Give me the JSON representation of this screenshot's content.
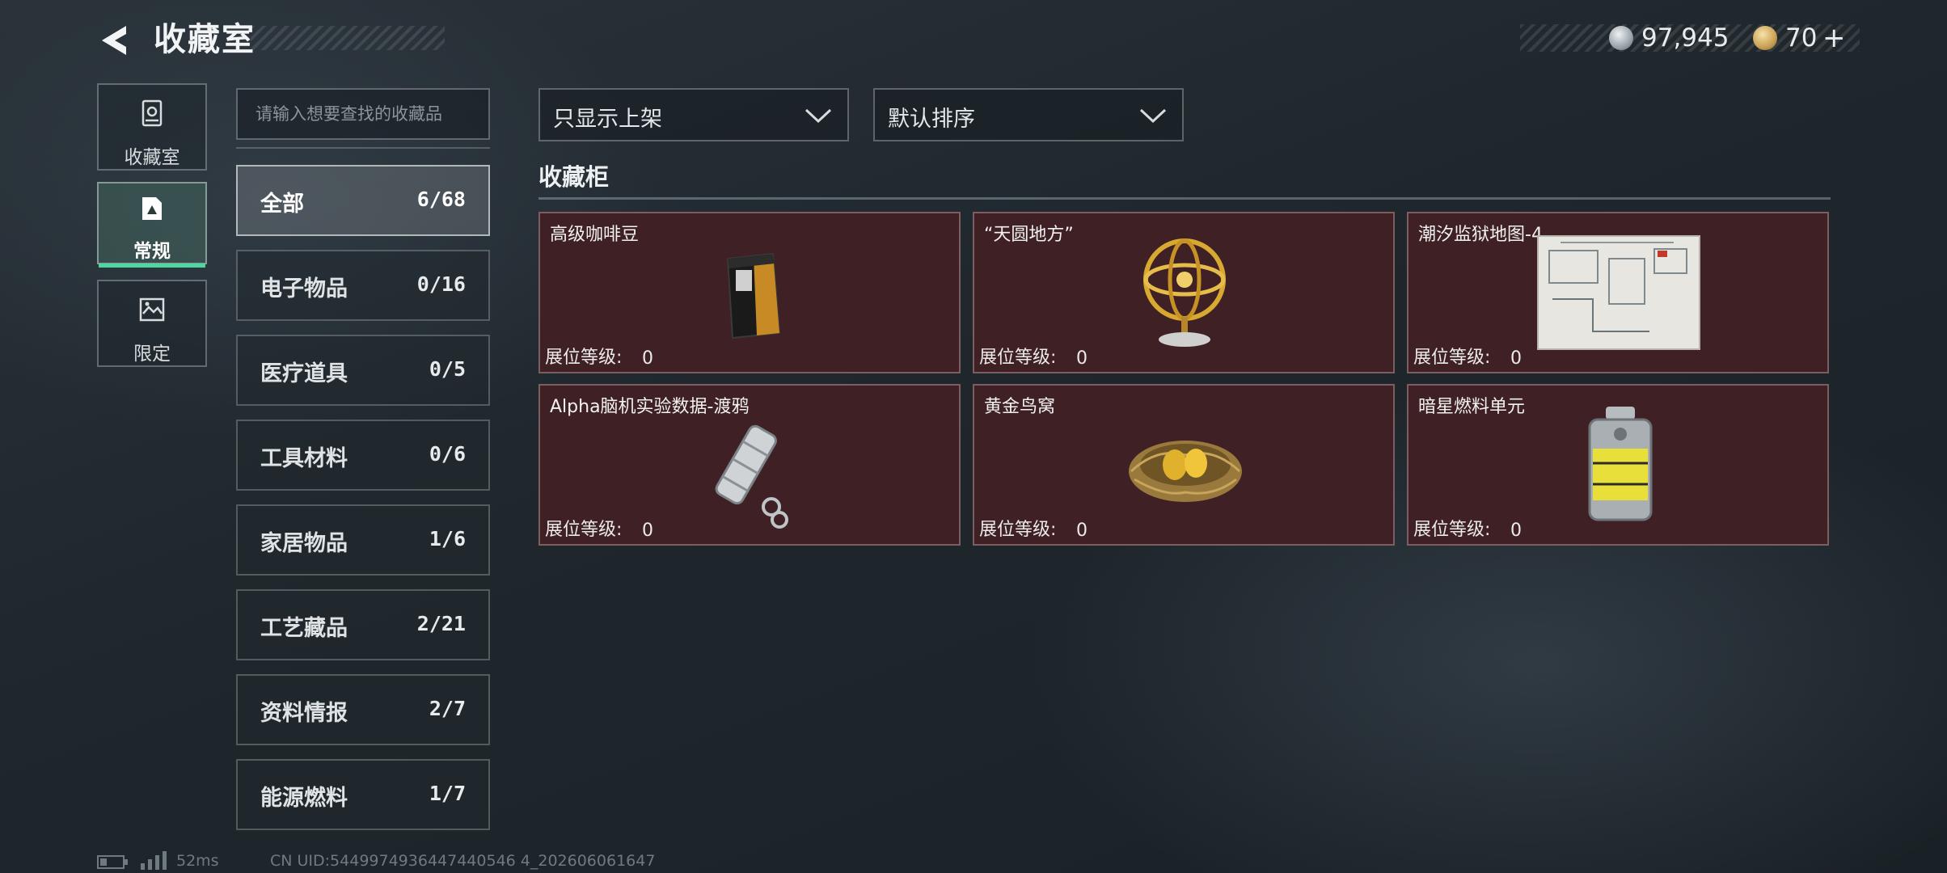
{
  "header": {
    "title": "收藏室",
    "currency": [
      {
        "icon": "silver-coin-icon",
        "value": "97,945",
        "color": "#c9ced2"
      },
      {
        "icon": "gold-coin-icon",
        "value": "70",
        "plus": "+",
        "color": "#d9b36a"
      }
    ]
  },
  "nav": {
    "items": [
      {
        "label": "收藏室",
        "icon": "cabinet-icon"
      },
      {
        "label": "常规",
        "icon": "frame-icon",
        "active": true
      },
      {
        "label": "限定",
        "icon": "map-frame-icon"
      }
    ]
  },
  "search": {
    "placeholder": "请输入想要查找的收藏品"
  },
  "categories": [
    {
      "name": "全部",
      "count": "6/68",
      "active": true
    },
    {
      "name": "电子物品",
      "count": "0/16"
    },
    {
      "name": "医疗道具",
      "count": "0/5"
    },
    {
      "name": "工具材料",
      "count": "0/6"
    },
    {
      "name": "家居物品",
      "count": "1/6"
    },
    {
      "name": "工艺藏品",
      "count": "2/21"
    },
    {
      "name": "资料情报",
      "count": "2/7"
    },
    {
      "name": "能源燃料",
      "count": "1/7"
    }
  ],
  "filters": {
    "shelf": "只显示上架",
    "sort": "默认排序"
  },
  "section": {
    "title": "收藏柜"
  },
  "items": [
    {
      "name": "高级咖啡豆",
      "level_label": "展位等级:",
      "level": "0",
      "icon": "coffee-bag-icon"
    },
    {
      "name": "“天圆地方”",
      "level_label": "展位等级:",
      "level": "0",
      "icon": "armillary-sphere-icon"
    },
    {
      "name": "潮汐监狱地图-4",
      "level_label": "展位等级:",
      "level": "0",
      "icon": "map-document-icon"
    },
    {
      "name": "Alpha脑机实验数据-渡鸦",
      "level_label": "展位等级:",
      "level": "0",
      "icon": "data-cylinder-icon"
    },
    {
      "name": "黄金鸟窝",
      "level_label": "展位等级:",
      "level": "0",
      "icon": "golden-nest-icon"
    },
    {
      "name": "暗星燃料单元",
      "level_label": "展位等级:",
      "level": "0",
      "icon": "fuel-canister-icon"
    }
  ],
  "colors": {
    "accent": "#4fd7a2",
    "card_bg": "#3f2024"
  },
  "footer": {
    "ping": "52ms",
    "uid": "CN UID:5449974936447440546 4_202606061647"
  }
}
